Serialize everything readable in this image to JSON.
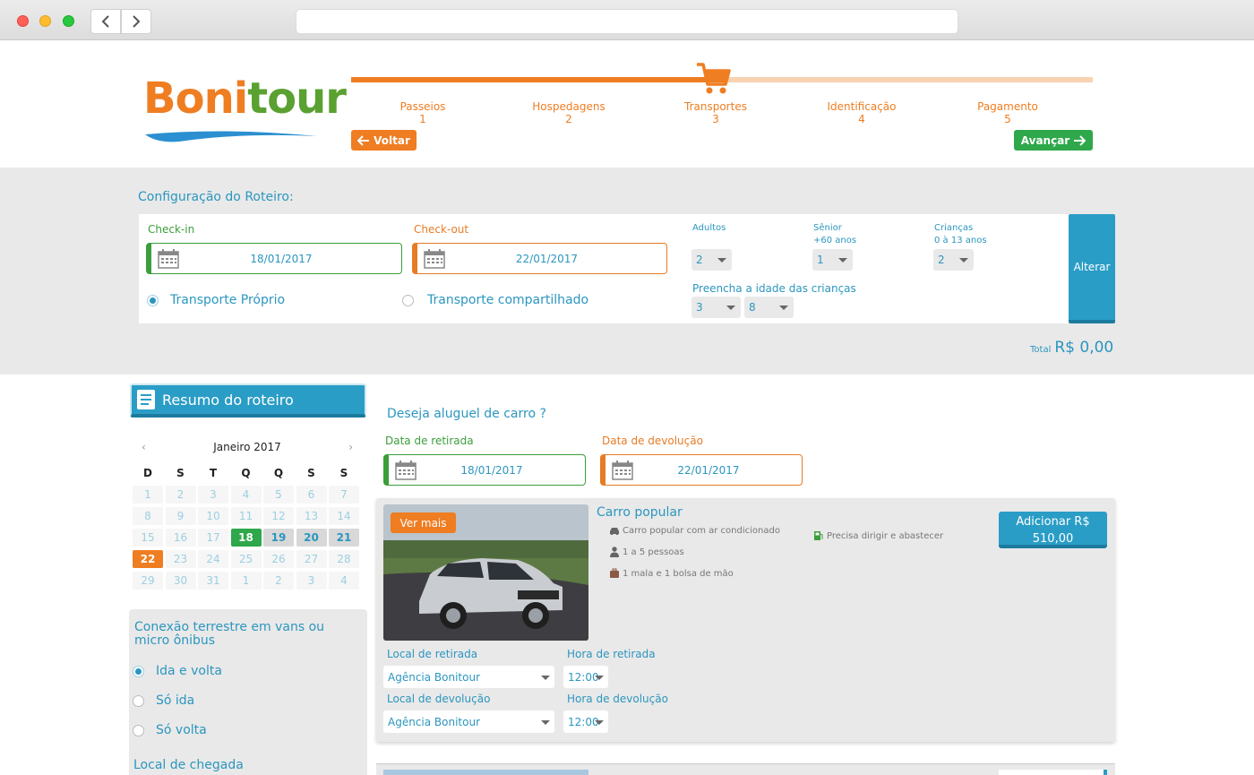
{
  "brand": {
    "logo_part1": "Boni",
    "logo_part2": "tour",
    "colors": {
      "orange": "#ef7d22",
      "green": "#2ea84a",
      "blue": "#2a9dc6",
      "gray": "#e9e9e9"
    }
  },
  "steps": {
    "items": [
      {
        "label": "Passeios",
        "num": "1"
      },
      {
        "label": "Hospedagens",
        "num": "2"
      },
      {
        "label": "Transportes",
        "num": "3"
      },
      {
        "label": "Identificação",
        "num": "4"
      },
      {
        "label": "Pagamento",
        "num": "5"
      }
    ],
    "current": 3,
    "progress": 0.49,
    "back_label": "Voltar",
    "next_label": "Avançar"
  },
  "config": {
    "title": "Configuração do Roteiro:",
    "checkin_label": "Check-in",
    "checkin_value": "18/01/2017",
    "checkout_label": "Check-out",
    "checkout_value": "22/01/2017",
    "adultos_label": "Adultos",
    "adultos_value": "2",
    "senior_label": "Sênior",
    "senior_sub": "+60 anos",
    "senior_value": "1",
    "criancas_label": "Crianças",
    "criancas_sub": "0 à 13 anos",
    "criancas_value": "2",
    "idade_label": "Preencha a idade das crianças",
    "idade_1": "3",
    "idade_2": "8",
    "transport_own": "Transporte Próprio",
    "transport_shared": "Transporte compartilhado",
    "transport_selected": "own",
    "alterar_label": "Alterar",
    "total_label": "Total",
    "total_value": "R$  0,00"
  },
  "sidebar": {
    "resumo_label": "Resumo do roteiro",
    "calendar": {
      "month": "Janeiro 2017",
      "prev": "‹",
      "next": "›",
      "weekdays": [
        "D",
        "S",
        "T",
        "Q",
        "Q",
        "S",
        "S"
      ],
      "weeks": [
        [
          "1",
          "2",
          "3",
          "4",
          "5",
          "6",
          "7"
        ],
        [
          "8",
          "9",
          "10",
          "11",
          "12",
          "13",
          "14"
        ],
        [
          "15",
          "16",
          "17",
          "18",
          "19",
          "20",
          "21"
        ],
        [
          "22",
          "23",
          "24",
          "25",
          "26",
          "27",
          "28"
        ],
        [
          "29",
          "30",
          "31",
          "1",
          "2",
          "3",
          "4"
        ]
      ],
      "checkin_day": "18",
      "stay_days": [
        "19",
        "20",
        "21"
      ],
      "checkout_day": "22"
    },
    "conexao_title": "Conexão terrestre em vans ou micro ônibus",
    "conexao_options": [
      "Ida e volta",
      "Só ida",
      "Só volta"
    ],
    "conexao_selected": 0,
    "local_chegada_label": "Local de chegada"
  },
  "rental": {
    "question": "Deseja aluguel de carro ?",
    "retirada_label": "Data de retirada",
    "retirada_value": "18/01/2017",
    "devolucao_label": "Data de devolução",
    "devolucao_value": "22/01/2017",
    "car": {
      "ver_mais": "Ver mais",
      "title": "Carro popular",
      "feature_ac": "Carro popular com ar condicionado",
      "feature_people": "1 a 5 pessoas",
      "feature_bags": "1 mala e 1 bolsa de mão",
      "feature_fuel": "Precisa dirigir e abastecer",
      "add_line1": "Adicionar R$",
      "add_line2": "510,00",
      "local_retirada_label": "Local de retirada",
      "local_retirada_value": "Agência Bonitour",
      "hora_retirada_label": "Hora de retirada",
      "hora_retirada_value": "12:00",
      "local_devolucao_label": "Local de devolução",
      "local_devolucao_value": "Agência Bonitour",
      "hora_devolucao_label": "Hora de devolução",
      "hora_devolucao_value": "12:00"
    }
  }
}
